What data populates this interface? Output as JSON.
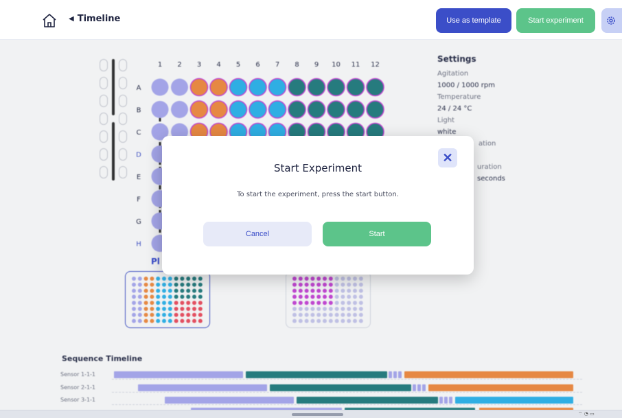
{
  "header": {
    "breadcrumb": "Timeline",
    "use_template_label": "Use as template",
    "start_experiment_label": "Start experiment"
  },
  "plate": {
    "columns": [
      "1",
      "2",
      "3",
      "4",
      "5",
      "6",
      "7",
      "8",
      "9",
      "10",
      "11",
      "12"
    ],
    "rows": [
      "A",
      "B",
      "C",
      "D",
      "E",
      "F",
      "G",
      "H"
    ],
    "label_partial": "Pl",
    "well_colors": {
      "lavender": "#a9a9f2",
      "orange": "#f38a3c",
      "sky": "#27b4ee",
      "teal": "#1e7b7d",
      "magenta_border": "#c840d8"
    }
  },
  "settings": {
    "title": "Settings",
    "agitation_label": "Agitation",
    "agitation_value": "1000 / 1000 rpm",
    "temperature_label": "Temperature",
    "temperature_value": "24 / 24 °C",
    "light_label": "Light",
    "light_value": "white",
    "exposure_label_partial": "ation",
    "duration_label_partial": "uration",
    "duration_value_partial": "seconds"
  },
  "sequence": {
    "title": "Sequence Timeline",
    "rows": [
      {
        "label": "Sensor 1-1-1"
      },
      {
        "label": "Sensor 2-1-1"
      },
      {
        "label": "Sensor 3-1-1"
      }
    ],
    "colors": {
      "lavender": "#a9a9f2",
      "teal": "#1e7b7d",
      "orange": "#f38a3c",
      "sky": "#27b4ee"
    }
  },
  "modal": {
    "title": "Start Experiment",
    "message": "To start the experiment, press the start button.",
    "cancel_label": "Cancel",
    "start_label": "Start"
  },
  "colors": {
    "primary": "#3b4ec8",
    "success": "#5cc48a",
    "settings_button_bg": "#c7d0f5"
  }
}
